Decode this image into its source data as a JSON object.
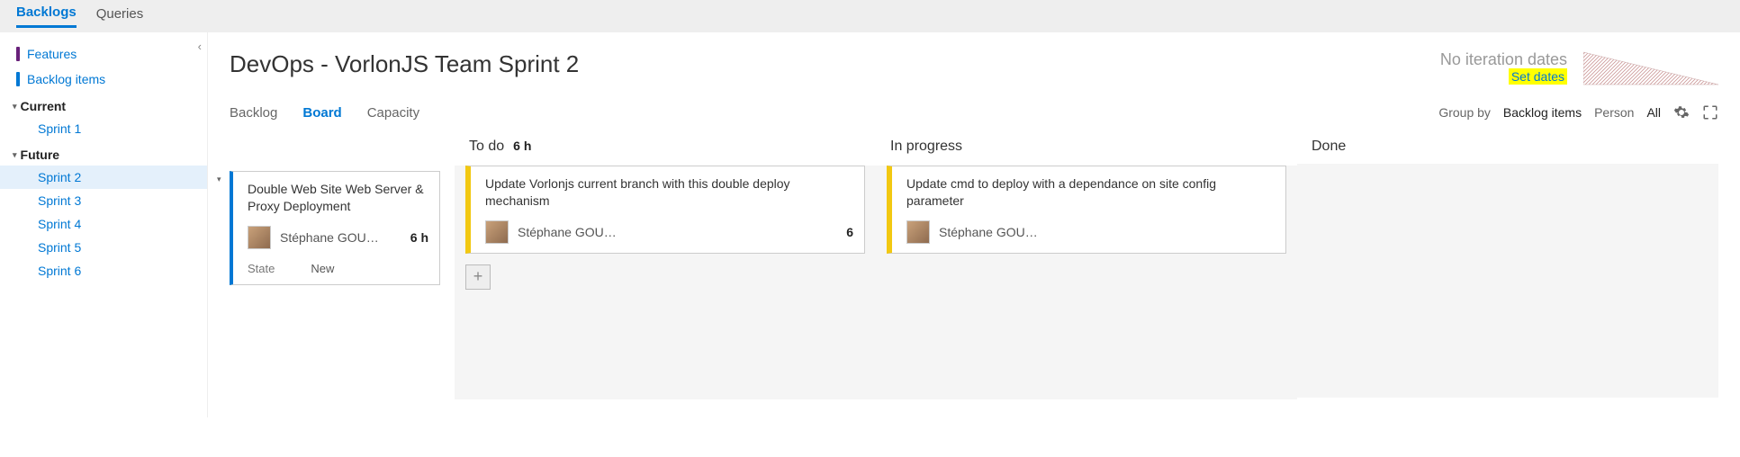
{
  "top_tabs": {
    "backlogs": "Backlogs",
    "queries": "Queries"
  },
  "sidebar": {
    "features": "Features",
    "backlog_items": "Backlog items",
    "groups": [
      {
        "label": "Current",
        "items": [
          "Sprint 1"
        ],
        "active_index": -1
      },
      {
        "label": "Future",
        "items": [
          "Sprint 2",
          "Sprint 3",
          "Sprint 4",
          "Sprint 5",
          "Sprint 6"
        ],
        "active_index": 0
      }
    ]
  },
  "page": {
    "title": "DevOps - VorlonJS Team Sprint 2",
    "no_dates": "No iteration dates",
    "set_dates": "Set dates",
    "view_tabs": {
      "backlog": "Backlog",
      "board": "Board",
      "capacity": "Capacity"
    },
    "group_by_label": "Group by",
    "group_by_value": "Backlog items",
    "person_label": "Person",
    "person_value": "All"
  },
  "board": {
    "columns": {
      "backlog": {
        "header": "",
        "hours": ""
      },
      "todo": {
        "header": "To do",
        "hours": "6 h"
      },
      "inprog": {
        "header": "In progress",
        "hours": ""
      },
      "done": {
        "header": "Done",
        "hours": ""
      }
    },
    "backlog_card": {
      "title": "Double Web Site Web Server & Proxy Deployment",
      "assignee": "Stéphane GOU…",
      "hours": "6 h",
      "state_label": "State",
      "state_value": "New"
    },
    "todo_card": {
      "title": "Update Vorlonjs current branch with this double deploy mechanism",
      "assignee": "Stéphane GOU…",
      "hours": "6"
    },
    "inprog_card": {
      "title": "Update cmd to deploy with a dependance on site config parameter",
      "assignee": "Stéphane GOU…"
    }
  }
}
